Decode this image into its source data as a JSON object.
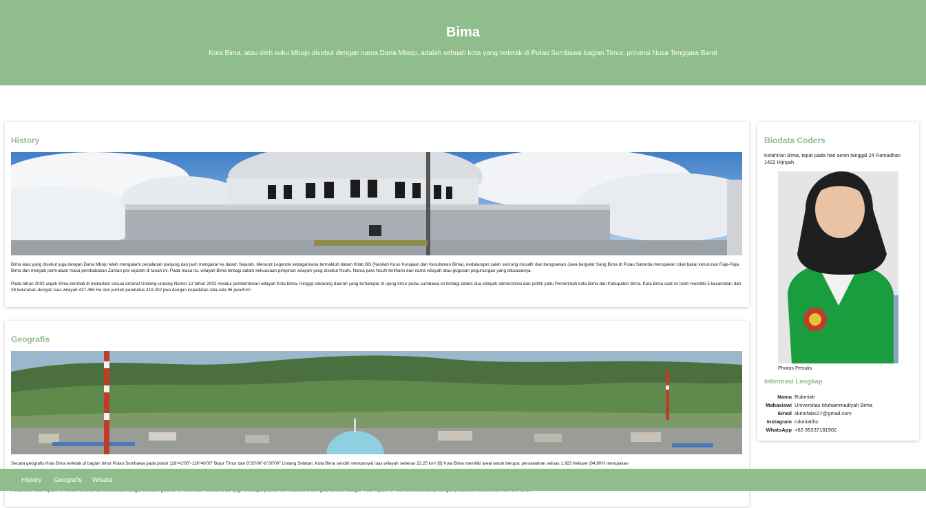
{
  "header": {
    "title": "Bima",
    "subtitle": "Kota Bima, atau oleh suku Mbojo disebut dengan nama Dana Mbojo, adalah sebuah kota yang terletak di Pulau Sumbawa bagian Timur, provinsi Nusa Tenggara Barat"
  },
  "history": {
    "title": "History",
    "para1": "Bima atau yang disebut juga dengan Dana Mbojo telah mengalami perjalanan panjang dan jauh mengakar ke dalam Sejarah. Menurut Legenda sebagaimana termaktub dalam Kitab BO (Naskah Kuno Kerajaan dan Kesultanan Bima), kedatangan salah seorang musafir dan bangsawan Jawa bergelar Sang Bima di Pulau Satonda merupakan cikal bakal keturunan Raja-Raja Bima dan menjadi permulaan masa pembabakan Zaman pra sejarah di tanah ini. Pada masa itu, wilayah Bima terbagi dalam kekuasaan pimpinan wilayah yang disebut Ncuhi. Nama para Ncuhi terilhami dari nama wilayah atau gugusan pegunungan yang dikuasainya.",
    "para2": "Pada tahun 2002 wajah Bima kembali di mekarkan sesuai amanat Undang-undang Nomor 13 tahun 2002 melalui pembentukan wilayah Kota Bima. Hingga sekarang daerah yang terhampar di ujung timur pulau sumbawa ini terbagi dalam dua wilayah administrasi dan politik yaitu Pemerintah kota Bima dan Kabupaten Bima. Kota Bima saat ini telah memiliki 5 kecamatan dan 38 kelurahan dengan luas wilayah 437.465 Ha dan jumlah penduduk 419.302 jiwa dengan kepadatan rata-rata 96 jiwa/Km²."
  },
  "geografis": {
    "title": "Geografis",
    "para1": "Secara geografis Kota Bima terletak di bagian timur Pulau Sumbawa pada posisi 118°41'00\"-118°48'00\" Bujur Timur dan 8°20'00\"-8°30'00\" Lintang Selatan. Kota Bima sendiri mempunyai luas wilayah sebesar 22,25 km².[6] Kota Bima memiliki areal tanah berupa: persawahan seluas 1.923 hektare (94,90% merupakan",
    "para2": "Pelabuhan Kota Teplan Air. Selain terkenal karena disebut sebagai kota paling panas di Indonesia, Kota Bima pun juga mendapat julukan lain. Kota Bima seringkali disebut sebagai \"Kota Teplan Air\" karena bersebelahan dengan pelabuhan berusia lebih dari 100 tahun."
  },
  "biodata": {
    "title": "Biodata Coders",
    "intro": "Kelahiran Bima, tepat pada hari senin tanggal 24 Ramadhan 1422 Hijriyah",
    "photo_caption": "Photos Penulis",
    "info_title": "Informasi Lengkap",
    "rows": [
      {
        "key": "Nama",
        "value": "Rukmiati"
      },
      {
        "key": "Mahasiswi",
        "value": "Universitas Muhammadiyah Bima"
      },
      {
        "key": "Email",
        "value": "skinnfabs27@gmail.com"
      },
      {
        "key": "Instagram",
        "value": "rukmiatihz"
      },
      {
        "key": "WhatsApp",
        "value": "+62 85337181902"
      }
    ]
  },
  "navbar": {
    "items": [
      "History",
      "Geografis",
      "Wisata"
    ]
  },
  "colors": {
    "accent": "#8fbd8c"
  }
}
